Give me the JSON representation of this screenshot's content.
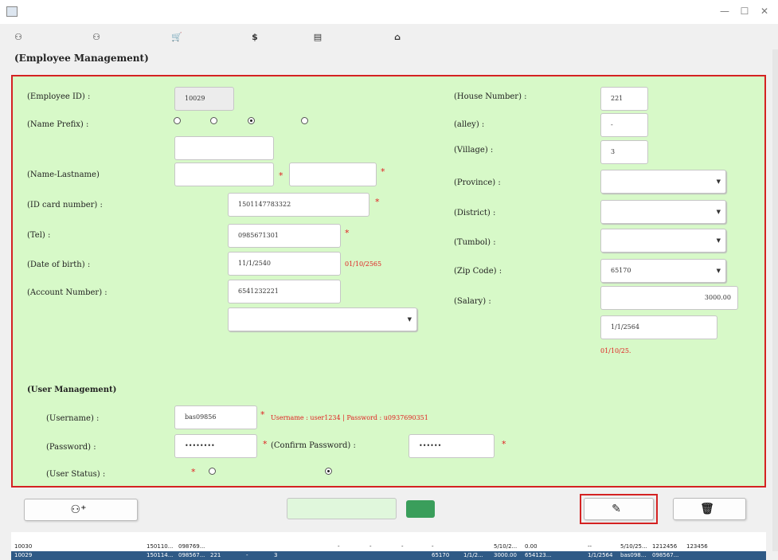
{
  "window": {
    "title": "",
    "minimize_glyph": "—",
    "maximize_glyph": "☐",
    "close_glyph": "✕"
  },
  "menu": [
    {
      "label": "",
      "icon": "employee-icon"
    },
    {
      "label": "",
      "icon": "customer-icon"
    },
    {
      "label": "",
      "icon": "cart-icon"
    },
    {
      "label": "",
      "icon": "dollar-icon"
    },
    {
      "label": "",
      "icon": "report-icon"
    },
    {
      "label": "",
      "icon": "home-icon"
    }
  ],
  "page_title": "(Employee Management)",
  "employee_form": {
    "employee_id": {
      "label": "(Employee ID) :",
      "value": "10029"
    },
    "name_prefix": {
      "label": "(Name Prefix) :",
      "options": [
        "",
        "",
        "",
        ""
      ],
      "selected_index": 2
    },
    "other_prefix": {
      "label": "",
      "value": ""
    },
    "name_lastname": {
      "label": "(Name-Lastname)",
      "first": "",
      "last": ""
    },
    "id_card": {
      "label": "(ID card number) :",
      "value": "1501147783322"
    },
    "tel": {
      "label": "(Tel) :",
      "value": "0985671301"
    },
    "dob": {
      "label": "(Date of birth) :",
      "value": "11/1/2540",
      "hint": "01/10/2565"
    },
    "account_number": {
      "label": "(Account Number) :",
      "value": "6541232221",
      "hint": ""
    },
    "bank_name": {
      "label": "",
      "value": ""
    },
    "house_number": {
      "label": "(House Number) :",
      "value": "221"
    },
    "alley": {
      "label": "(alley) :",
      "value": "-"
    },
    "village": {
      "label": "(Village) :",
      "value": "3"
    },
    "province": {
      "label": "(Province) :",
      "value": ""
    },
    "district": {
      "label": "(District) :",
      "value": ""
    },
    "subdistrict": {
      "label": "(Tumbol) :",
      "value": ""
    },
    "zip_code": {
      "label": "(Zip Code) :",
      "value": "65170"
    },
    "salary": {
      "label": "(Salary) :",
      "value": "3000.00",
      "unit": ""
    },
    "start_date": {
      "label": "",
      "value": "1/1/2564",
      "hint": "01/10/25."
    }
  },
  "user_management": {
    "title": "(User Management)",
    "username": {
      "label": "(Username) :",
      "value": "bas09856"
    },
    "username_hint": "Username : user1234 | Password : u0937690351",
    "password": {
      "label": "(Password) :",
      "value": "••••••••"
    },
    "confirm_password": {
      "label": "(Confirm Password) :",
      "value": "••••••"
    },
    "user_status": {
      "label": "(User Status) :",
      "options": [
        "",
        ""
      ],
      "selected_index": 1
    }
  },
  "actions": {
    "add_label": "",
    "search_label": "",
    "search_value": "",
    "search_button_label": "",
    "edit_label": "",
    "delete_label": ""
  },
  "table": {
    "columns": [
      "",
      "",
      "",
      "",
      "",
      "",
      "",
      "",
      "",
      "",
      "",
      "",
      "",
      "",
      "",
      "",
      "",
      "",
      "",
      "",
      "",
      "",
      ""
    ],
    "rows": [
      [
        "10030",
        "",
        "",
        "",
        "150110...",
        "098769...",
        "",
        "",
        "",
        "",
        "-",
        "-",
        "-",
        "-",
        "",
        "5/10/2...",
        "0.00",
        "",
        "--",
        "5/10/25...",
        "1212456",
        "123456",
        ""
      ],
      [
        "10029",
        "",
        "",
        "",
        "150114...",
        "098567...",
        "221",
        "-",
        "3",
        "",
        "",
        "",
        "",
        "65170",
        "1/1/2...",
        "3000.00",
        "654123...",
        "",
        "1/1/2564",
        "bas098...",
        "098567...",
        "",
        ""
      ]
    ]
  },
  "colors": {
    "panel_bg": "#d7f9c8",
    "panel_border": "#d42222",
    "required": "#e02020",
    "selected_row": "#2f5a86",
    "search_button": "#3a9e5b"
  }
}
